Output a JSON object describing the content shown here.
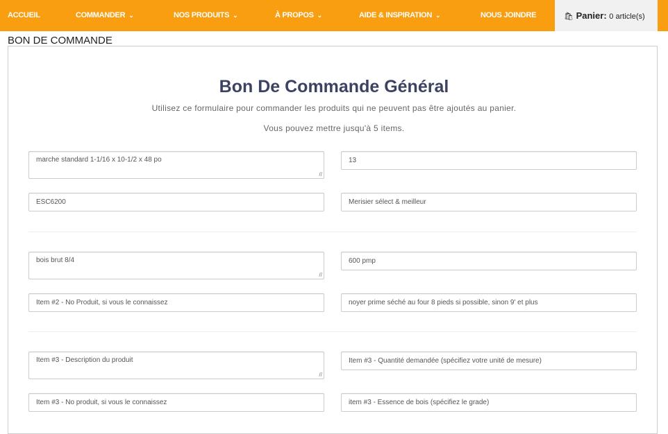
{
  "nav": {
    "items": [
      {
        "label": "ACCUEIL"
      },
      {
        "label": "COMMANDER",
        "dropdown": true
      },
      {
        "label": "NOS PRODUITS",
        "dropdown": true
      },
      {
        "label": "À PROPOS",
        "dropdown": true
      },
      {
        "label": "AIDE & INSPIRATION",
        "dropdown": true
      },
      {
        "label": "NOUS JOINDRE"
      }
    ],
    "cart": {
      "label": "Panier:",
      "count": "0 article(s)",
      "icon": "shopping-bag-icon"
    },
    "color": "#f89e10"
  },
  "page_title": "BON DE COMMANDE",
  "form": {
    "title": "Bon De Commande Général",
    "intro": "Utilisez ce formulaire pour commander les produits qui ne peuvent pas être ajoutés au panier.",
    "limit": "Vous pouvez mettre jusqu'à 5 items.",
    "items": [
      {
        "description": "marche standard 1-1/16 x 10-1/2 x 48 po",
        "quantity": "13",
        "product_no": "ESC6200",
        "wood": "Merisier sélect & meilleur"
      },
      {
        "description": "bois brut 8/4",
        "quantity": "600 pmp",
        "product_no_placeholder": "Item #2 - No Produit, si vous le connaissez",
        "wood": "noyer prime séché au four 8 pieds si possible, sinon 9' et plus"
      },
      {
        "description_placeholder": "Item #3 - Description du produit",
        "quantity_placeholder": "Item #3 - Quantité demandée (spécifiez votre unité de mesure)",
        "product_no_placeholder": "Item #3 - No produit, si vous le connaissez",
        "wood_placeholder": "item #3 - Essence de bois (spécifiez le grade)"
      }
    ]
  }
}
